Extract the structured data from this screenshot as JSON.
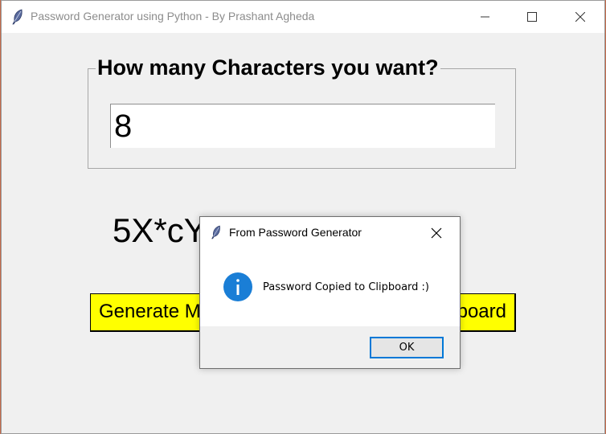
{
  "window": {
    "title": "Password Generator using Python - By Prashant Agheda",
    "icons": {
      "app": "feather-icon",
      "minimize": "minimize-icon",
      "maximize": "maximize-icon",
      "close": "close-icon"
    }
  },
  "main": {
    "frame_label": "How many Characters you want?",
    "length_input_value": "8",
    "password_display": "5X*cY",
    "generate_button_label": "Generate My",
    "copy_button_label": "board",
    "button_color": "#ffff00"
  },
  "dialog": {
    "title": "From Password Generator",
    "message": "Password Copied to Clipboard :)",
    "ok_label": "OK",
    "icon": "info-icon",
    "accent_color": "#0078d7"
  }
}
